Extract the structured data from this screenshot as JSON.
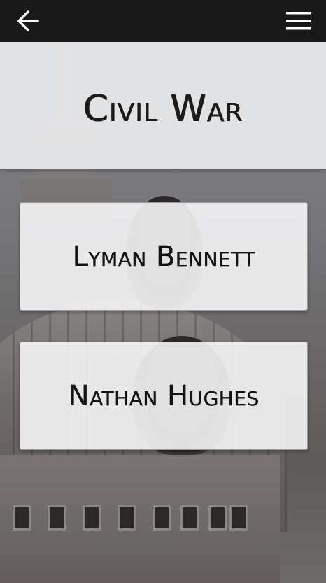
{
  "navbar": {
    "back_icon": "arrow-left-icon",
    "menu_icon": "hamburger-menu-icon",
    "background": "#1a1919"
  },
  "header": {
    "title": "Civil War"
  },
  "cards": [
    {
      "label": "Lyman Bennett"
    },
    {
      "label": "Nathan Hughes"
    }
  ],
  "colors": {
    "title_band": "#e8e9eb",
    "card_background": "#f5f5f6",
    "text": "#1b1b1b"
  }
}
